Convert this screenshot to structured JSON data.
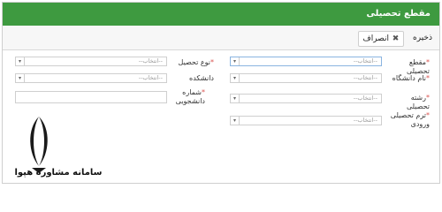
{
  "panel": {
    "title": "مقطع تحصیلی"
  },
  "toolbar": {
    "save_label": "ذخیره",
    "cancel_label": "انصراف"
  },
  "form": {
    "placeholder": "--انتخاب--",
    "degree_label": "مقطع تحصیلی",
    "university_label": "نام دانشگاه",
    "major_label": "رشته تحصیلی",
    "entry_term_label": "ترم تحصیلی ورودی",
    "study_type_label": "نوع تحصیل",
    "faculty_label": "دانشکده",
    "student_number_label": "شماره دانشجویی",
    "required_mark": "*"
  },
  "watermark": {
    "text": "سامانه مشاوره هپوا"
  }
}
